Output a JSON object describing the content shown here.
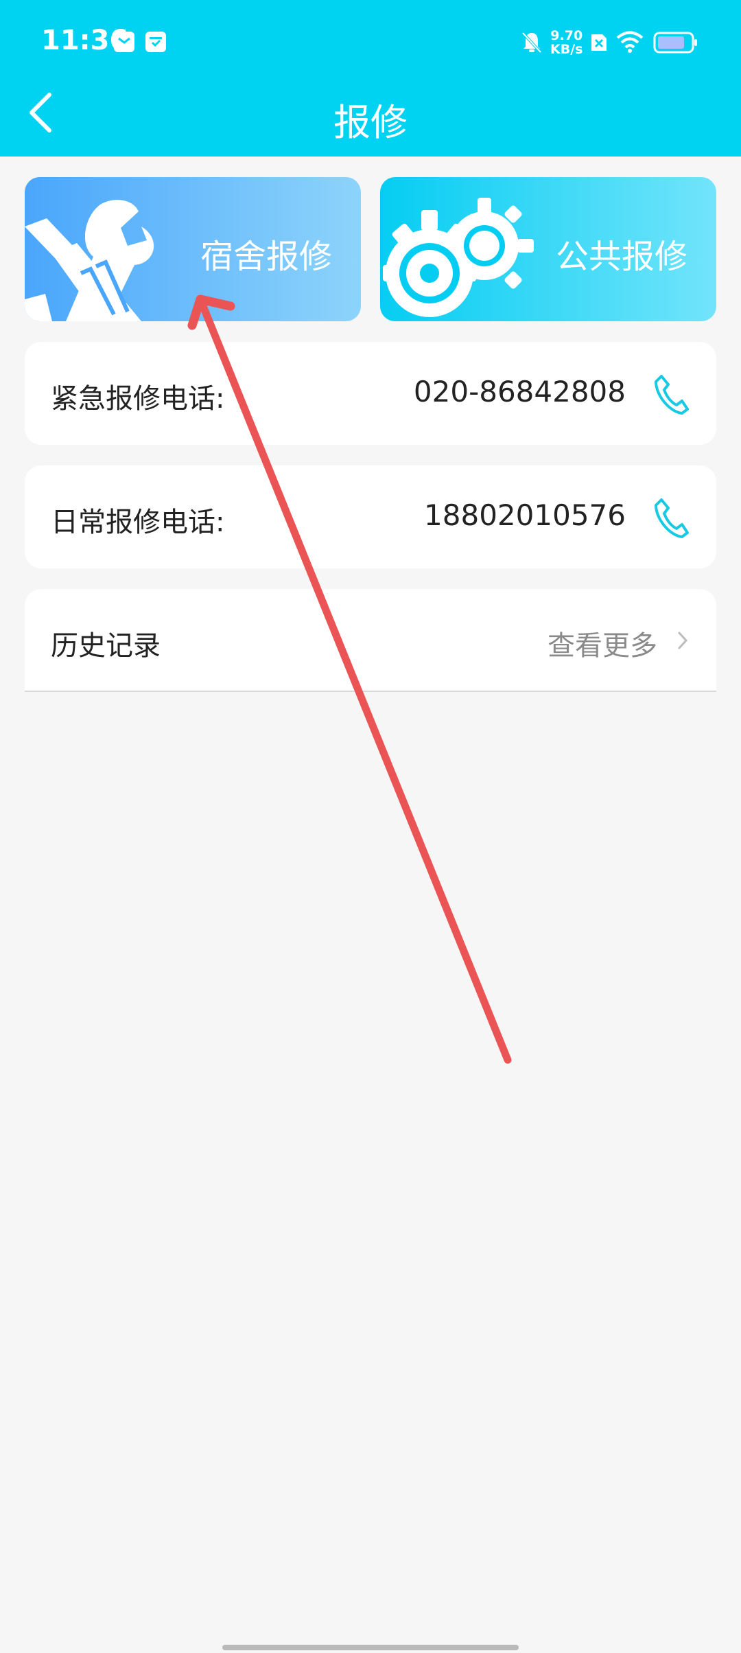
{
  "status_bar": {
    "time": "11:36",
    "net_speed_value": "9.70",
    "net_speed_unit": "KB/s"
  },
  "header": {
    "title": "报修"
  },
  "cards": [
    {
      "label": "宿舍报修",
      "icon": "wrench-screwdriver-icon"
    },
    {
      "label": "公共报修",
      "icon": "gears-icon"
    }
  ],
  "hotlines": [
    {
      "label": "紧急报修电话:",
      "number": "020-86842808",
      "icon": "phone-icon"
    },
    {
      "label": "日常报修电话:",
      "number": "18802010576",
      "icon": "phone-icon"
    }
  ],
  "history": {
    "label": "历史记录",
    "more": "查看更多"
  },
  "colors": {
    "accent": "#00d2f2",
    "phone_icon": "#18c9e3",
    "annotation_arrow": "#ea5455"
  }
}
